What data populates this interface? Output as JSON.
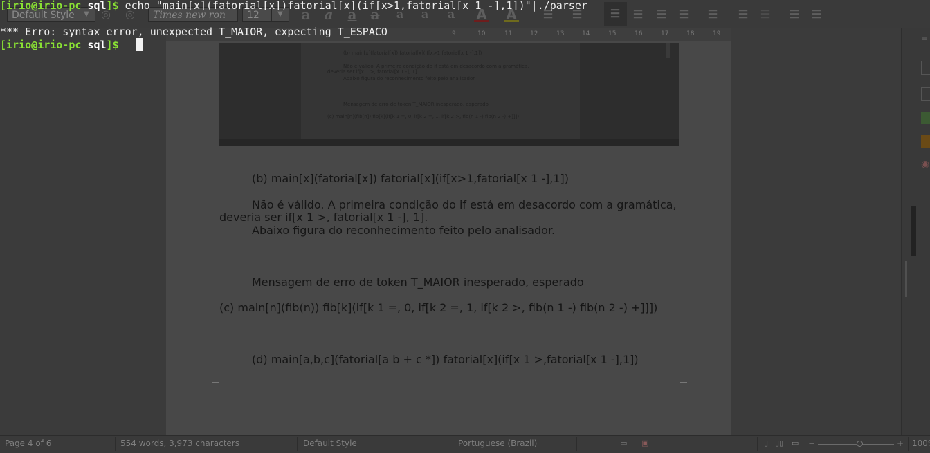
{
  "terminal": {
    "line1": {
      "user_host": "irio@irio-pc",
      "dir": "sql",
      "prompt_end": "$",
      "command": " echo \"main[x](fatorial[x])fatorial[x](if[x>1,fatorial[x 1 -],1])\"|./parser"
    },
    "line2": "*** Erro: syntax error, unexpected T_MAIOR, expecting T_ESPACO",
    "line3": {
      "user_host": "irio@irio-pc",
      "dir": "sql",
      "prompt_end": "$"
    }
  },
  "toolbar": {
    "paragraph_style": "Default Style",
    "font_name": "Times new ron",
    "font_size": "12"
  },
  "ruler": {
    "ticks": [
      "9",
      "10",
      "11",
      "12",
      "13",
      "14",
      "15",
      "16",
      "17",
      "18",
      "19"
    ]
  },
  "embedded_screenshot": {
    "line1": "(b) main[x](fatorial[x]) fatorial[x](if[x>1,fatorial[x 1 -],1])",
    "line2": "Não é válido. A primeira condição do if está em desacordo com a gramática,",
    "line3": "deveria ser if[x 1 >, fatorial[x 1 -], 1].",
    "line4": "Abaixo figura do reconhecimento feito pelo analisador.",
    "line5": "Mensagem de erro de token T_MAIOR inesperado, esperado",
    "line6": "(c) main[n](fib[n]) fib[k](if[k 1 =, 0, if[k 2 =, 1, if[k 2 >, fib(n 1 -) fib(n 2 -) +]]])"
  },
  "document": {
    "para_b": "(b) main[x](fatorial[x]) fatorial[x](if[x>1,fatorial[x 1 -],1])",
    "para_invalid_1": "Não é válido. A primeira condição do if está em desacordo com a gramática,",
    "para_invalid_2": "deveria ser if[x 1 >, fatorial[x 1 -], 1].",
    "para_figure": "Abaixo figura do reconhecimento feito pelo analisador.",
    "para_error": "Mensagem de erro de token T_MAIOR inesperado, esperado",
    "para_c": "(c) main[n](fib(n)) fib[k](if[k 1 =, 0, if[k 2 =, 1, if[k 2 >, fib(n 1 -) fib(n 2 -) +]]])",
    "para_d": "(d) main[a,b,c](fatorial[a b + c *]) fatorial[x](if[x 1 >,fatorial[x 1 -],1])"
  },
  "statusbar": {
    "page": "Page 4 of 6",
    "words": "554 words, 3,973 characters",
    "style": "Default Style",
    "language": "Portuguese (Brazil)",
    "zoom_minus": "−",
    "zoom_plus": "+",
    "zoom": "100%"
  },
  "colors": {
    "terminal_green": "#8ae234",
    "page_bg": "#484848",
    "ui_bg": "#3b3b3b"
  }
}
